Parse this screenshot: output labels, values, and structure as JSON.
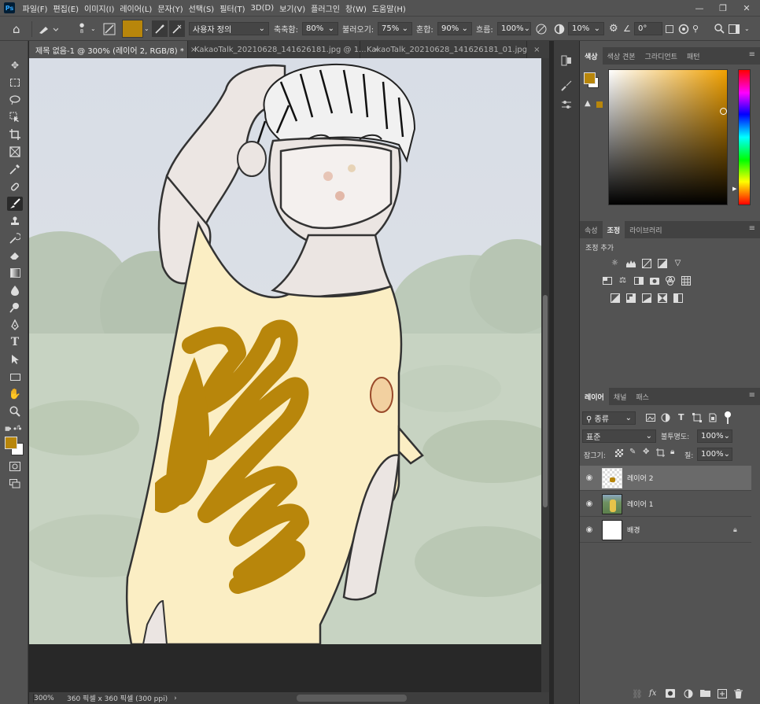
{
  "menubar": {
    "logo": "Ps",
    "items": [
      "파일(F)",
      "편집(E)",
      "이미지(I)",
      "레이어(L)",
      "문자(Y)",
      "선택(S)",
      "필터(T)",
      "3D(D)",
      "보기(V)",
      "플러그인",
      "창(W)",
      "도움말(H)"
    ],
    "controls": {
      "minimize": "—",
      "restore": "❐",
      "close": "✕"
    }
  },
  "options": {
    "brush_size": "8",
    "preset": "사용자 정의",
    "smoothing_label": "축축함:",
    "smoothing_value": "80%",
    "load_label": "불러오기:",
    "load_value": "75%",
    "mix_label": "혼합:",
    "mix_value": "90%",
    "flow_label": "흐름:",
    "flow_value": "100%",
    "smooth_value": "10%",
    "angle_value": "0°",
    "color": "#b8860b"
  },
  "tabs": [
    {
      "label": "제목 없음-1 @ 300% (레이어 2, RGB/8) *",
      "close": "×"
    },
    {
      "label": "KakaoTalk_20210628_141626181.jpg @ 1...",
      "close": "×"
    },
    {
      "label": "KakaoTalk_20210628_141626181_01.jpg",
      "close": "×"
    }
  ],
  "status": {
    "zoom": "300%",
    "doc_info": "360 픽셀 x 360 픽셀 (300 ppi)",
    "arrow": "›"
  },
  "colors": {
    "foreground": "#b8860b",
    "background": "#ffffff"
  },
  "color_panel": {
    "tabs": [
      "색상",
      "색상 견본",
      "그라디언트",
      "패턴"
    ]
  },
  "adjust_panel": {
    "tabs": [
      "속성",
      "조정",
      "라이브러리"
    ],
    "title": "조정 추가"
  },
  "layers_panel": {
    "tabs": [
      "레이어",
      "채널",
      "패스"
    ],
    "filter": "종류",
    "blend": "표준",
    "opacity_label": "불투명도:",
    "opacity": "100%",
    "lock_label": "잠그기:",
    "fill_label": "칠:",
    "fill": "100%",
    "layers": [
      {
        "name": "레이어 2"
      },
      {
        "name": "레이어 1"
      },
      {
        "name": "배경"
      }
    ]
  }
}
